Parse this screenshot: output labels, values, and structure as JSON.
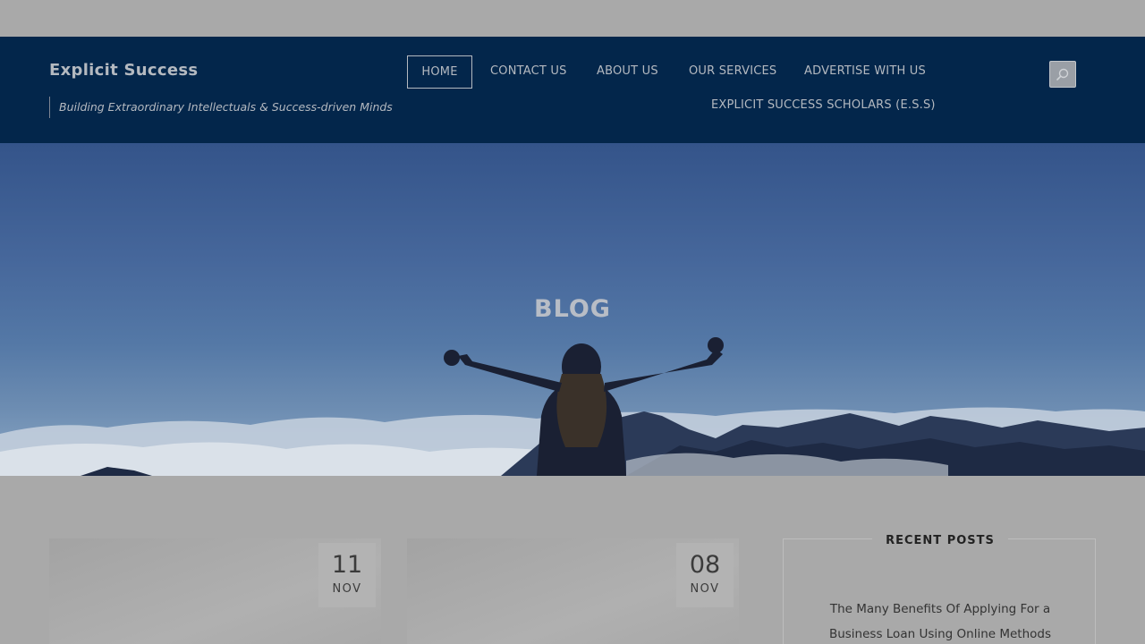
{
  "header": {
    "site_title": "Explicit Success",
    "tagline": "Building Extraordinary Intellectuals & Success-driven Minds",
    "nav": {
      "home": "HOME",
      "contact": "CONTACT US",
      "about": "ABOUT US",
      "services": "OUR SERVICES",
      "advertise": "ADVERTISE WITH US",
      "scholars": "EXPLICIT SUCCESS SCHOLARS (E.S.S)"
    },
    "search_icon": "search-icon"
  },
  "hero": {
    "title": "BLOG"
  },
  "posts": [
    {
      "day": "11",
      "month": "NOV"
    },
    {
      "day": "08",
      "month": "NOV"
    }
  ],
  "sidebar": {
    "recent_posts": {
      "title": "RECENT POSTS",
      "items": [
        "The Many Benefits Of Applying For a Business Loan Using Online Methods"
      ]
    }
  },
  "colors": {
    "header_bg": "#03264b",
    "overlay_bg": "#a9a9a9"
  }
}
